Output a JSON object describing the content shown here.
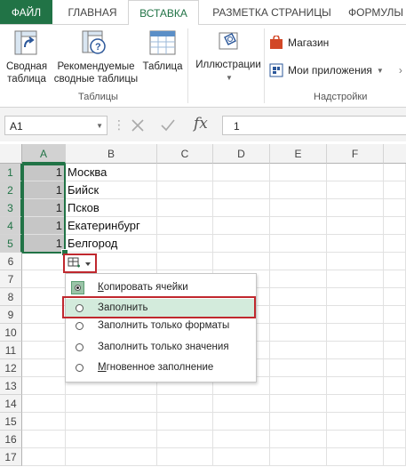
{
  "tabs": {
    "file": "ФАЙЛ",
    "items": [
      "ГЛАВНАЯ",
      "ВСТАВКА",
      "РАЗМЕТКА СТРАНИЦЫ",
      "ФОРМУЛЫ"
    ],
    "active": "ВСТАВКА"
  },
  "ribbon": {
    "pivot_table": "Сводная\nтаблица",
    "recommended_pivots": "Рекомендуемые\nсводные таблицы",
    "table": "Таблица",
    "group_tables": "Таблицы",
    "illustrations": "Иллюстрации",
    "store": "Магазин",
    "my_apps": "Мои приложения",
    "group_addins": "Надстройки"
  },
  "formula_bar": {
    "name_box": "A1",
    "fx_label": "fx",
    "value": "1"
  },
  "grid": {
    "columns": [
      "A",
      "B",
      "C",
      "D",
      "E",
      "F"
    ],
    "rows": [
      "1",
      "2",
      "3",
      "4",
      "5",
      "6",
      "7",
      "8",
      "9",
      "10",
      "11",
      "12",
      "13",
      "14",
      "15",
      "16",
      "17"
    ],
    "col_a": [
      "1",
      "1",
      "1",
      "1",
      "1"
    ],
    "col_b": [
      "Москва",
      "Бийск",
      "Псков",
      "Екатеринбург",
      "Белгород"
    ]
  },
  "autofill_menu": {
    "items": [
      "Копировать ячейки",
      "Заполнить",
      "Заполнить только форматы",
      "Заполнить только значения",
      "Мгновенное заполнение"
    ],
    "selected_index": 0,
    "highlighted_index": 1
  },
  "colors": {
    "excel_green": "#217346",
    "highlight_red": "#c0282e",
    "menu_hover": "#d3ebdc"
  }
}
